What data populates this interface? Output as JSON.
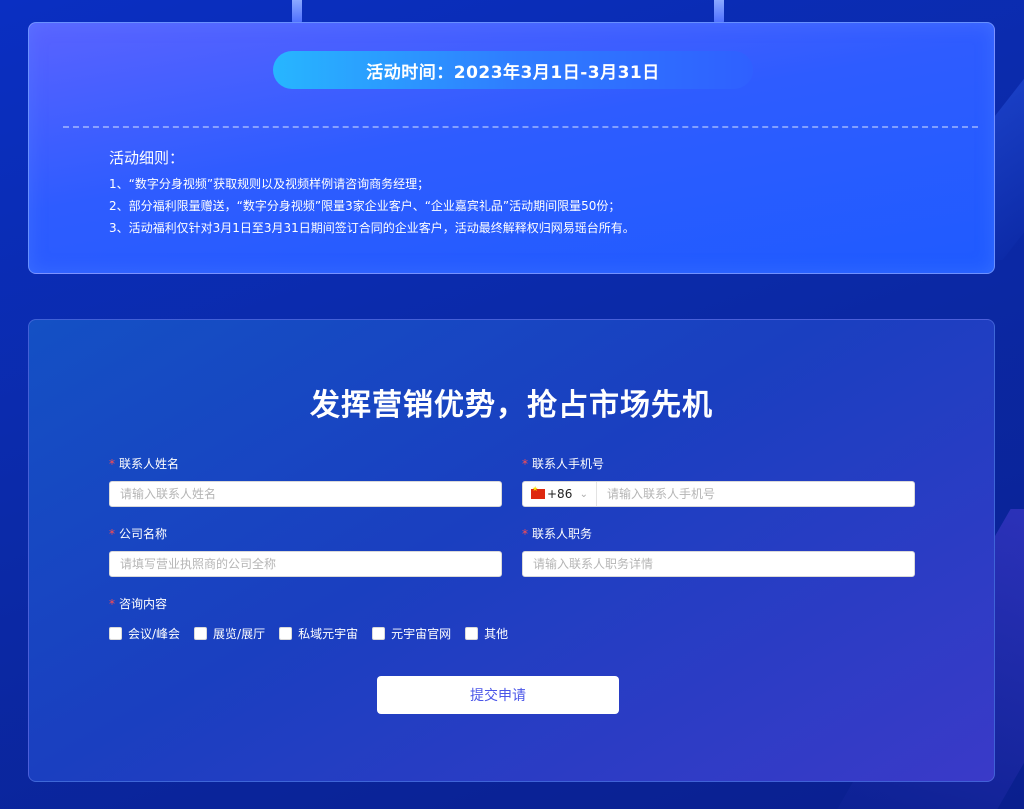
{
  "activity": {
    "time_text": "活动时间：2023年3月1日-3月31日",
    "rules_title": "活动细则：",
    "rules": [
      "1、“数字分身视频”获取规则以及视频样例请咨询商务经理；",
      "2、部分福利限量赠送，“数字分身视频”限量3家企业客户、“企业嘉宾礼品”活动期间限量50份；",
      "3、活动福利仅针对3月1日至3月31日期间签订合同的企业客户，活动最终解释权归网易瑶台所有。"
    ]
  },
  "form": {
    "title": "发挥营销优势，抢占市场先机",
    "required_mark": "*",
    "name": {
      "label": "联系人姓名",
      "placeholder": "请输入联系人姓名"
    },
    "phone": {
      "label": "联系人手机号",
      "country_code": "+86",
      "placeholder": "请输入联系人手机号"
    },
    "company": {
      "label": "公司名称",
      "placeholder": "请填写营业执照商的公司全称"
    },
    "position": {
      "label": "联系人职务",
      "placeholder": "请输入联系人职务详情"
    },
    "consult": {
      "label": "咨询内容",
      "options": [
        "会议/峰会",
        "展览/展厅",
        "私域元宇宙",
        "元宇宙官网",
        "其他"
      ]
    },
    "submit_label": "提交申请"
  },
  "colors": {
    "required": "#ff4d4f",
    "submit_text": "#4a55e8"
  }
}
